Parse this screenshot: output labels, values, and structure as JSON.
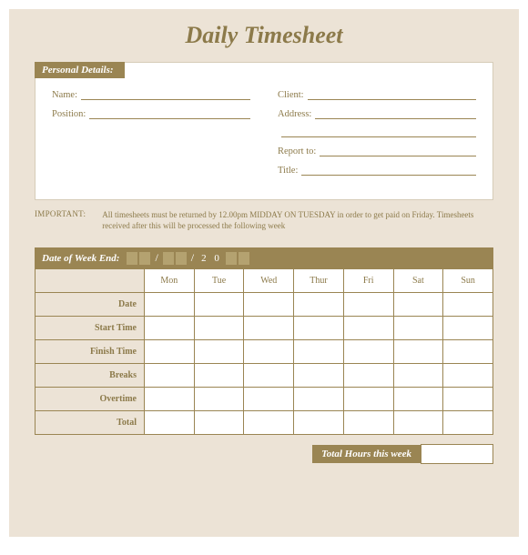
{
  "title": "Daily Timesheet",
  "personal": {
    "heading": "Personal Details:",
    "left": [
      {
        "label": "Name:"
      },
      {
        "label": "Position:"
      }
    ],
    "right": [
      {
        "label": "Client:"
      },
      {
        "label": "Address:"
      },
      {
        "label": ""
      },
      {
        "label": "Report to:"
      },
      {
        "label": "Title:"
      }
    ]
  },
  "important": {
    "label": "IMPORTANT:",
    "text": "All timesheets must be returned by 12.00pm MIDDAY ON TUESDAY in order to get paid on Friday. Timesheets received after this will be processed the following week"
  },
  "weekEnd": {
    "label": "Date of Week End:",
    "yearPrefix": "2 0"
  },
  "grid": {
    "days": [
      "Mon",
      "Tue",
      "Wed",
      "Thur",
      "Fri",
      "Sat",
      "Sun"
    ],
    "rows": [
      "Date",
      "Start Time",
      "Finish Time",
      "Breaks",
      "Overtime",
      "Total"
    ]
  },
  "totals": {
    "label": "Total Hours this week"
  }
}
